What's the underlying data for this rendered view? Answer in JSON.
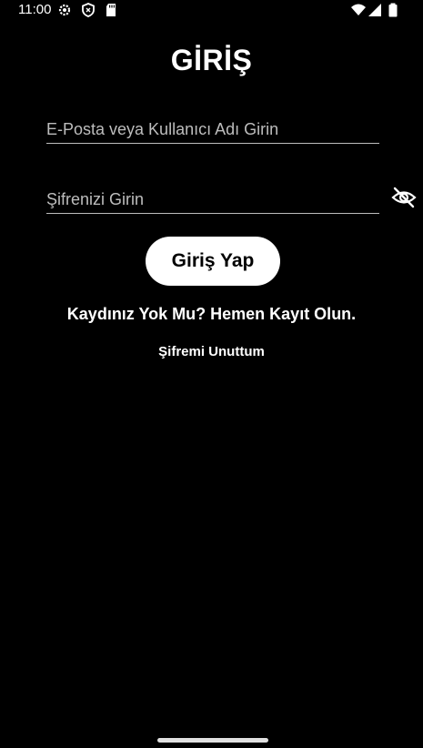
{
  "status_bar": {
    "time": "11:00",
    "icons": [
      "settings-icon",
      "shield-icon",
      "sd-card-icon",
      "wifi-icon",
      "signal-icon",
      "battery-icon"
    ]
  },
  "login": {
    "title": "GİRİŞ",
    "email_placeholder": "E-Posta veya Kullanıcı Adı Girin",
    "email_value": "",
    "password_placeholder": "Şifrenizi Girin",
    "password_value": "",
    "password_toggle_icon": "eye-off-icon",
    "submit_label": "Giriş Yap",
    "register_text": "Kaydınız Yok Mu? Hemen Kayıt Olun.",
    "forgot_text": "Şifremi Unuttum"
  },
  "colors": {
    "background": "#000000",
    "text": "#ffffff",
    "button_bg": "#ffffff",
    "button_text": "#000000",
    "underline": "#bdbdbd"
  }
}
